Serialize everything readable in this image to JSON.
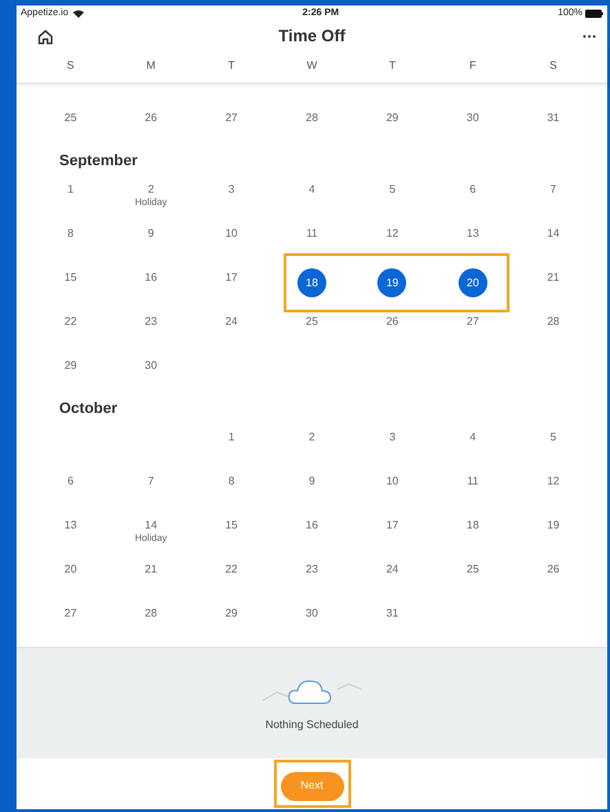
{
  "status_bar": {
    "carrier": "Appetize.io",
    "time": "2:26 PM",
    "battery": "100%"
  },
  "header": {
    "title": "Time Off"
  },
  "weekdays": [
    "S",
    "M",
    "T",
    "W",
    "T",
    "F",
    "S"
  ],
  "sections": [
    {
      "weeks": [
        {
          "highlighted": false,
          "days": [
            {
              "kind": "date",
              "day": "25",
              "selected": false
            },
            {
              "kind": "date",
              "day": "26",
              "selected": false
            },
            {
              "kind": "date",
              "day": "27",
              "selected": false
            },
            {
              "kind": "date",
              "day": "28",
              "selected": false
            },
            {
              "kind": "date",
              "day": "29",
              "selected": false
            },
            {
              "kind": "date",
              "day": "30",
              "selected": false
            },
            {
              "kind": "date",
              "day": "31",
              "selected": false
            }
          ]
        }
      ]
    },
    {
      "title": "September",
      "weeks": [
        {
          "highlighted": false,
          "days": [
            {
              "kind": "date",
              "day": "1",
              "selected": false
            },
            {
              "kind": "date",
              "day": "2",
              "selected": false,
              "note": "Holiday"
            },
            {
              "kind": "date",
              "day": "3",
              "selected": false
            },
            {
              "kind": "date",
              "day": "4",
              "selected": false
            },
            {
              "kind": "date",
              "day": "5",
              "selected": false
            },
            {
              "kind": "date",
              "day": "6",
              "selected": false
            },
            {
              "kind": "date",
              "day": "7",
              "selected": false
            }
          ]
        },
        {
          "highlighted": false,
          "days": [
            {
              "kind": "date",
              "day": "8",
              "selected": false
            },
            {
              "kind": "date",
              "day": "9",
              "selected": false
            },
            {
              "kind": "date",
              "day": "10",
              "selected": false
            },
            {
              "kind": "date",
              "day": "11",
              "selected": false
            },
            {
              "kind": "date",
              "day": "12",
              "selected": false
            },
            {
              "kind": "date",
              "day": "13",
              "selected": false
            },
            {
              "kind": "date",
              "day": "14",
              "selected": false
            }
          ]
        },
        {
          "highlighted": true,
          "days": [
            {
              "kind": "date",
              "day": "15",
              "selected": false
            },
            {
              "kind": "date",
              "day": "16",
              "selected": false
            },
            {
              "kind": "date",
              "day": "17",
              "selected": false
            },
            {
              "kind": "date",
              "day": "18",
              "selected": true
            },
            {
              "kind": "date",
              "day": "19",
              "selected": true
            },
            {
              "kind": "date",
              "day": "20",
              "selected": true
            },
            {
              "kind": "date",
              "day": "21",
              "selected": false
            }
          ]
        },
        {
          "highlighted": false,
          "days": [
            {
              "kind": "date",
              "day": "22",
              "selected": false
            },
            {
              "kind": "date",
              "day": "23",
              "selected": false
            },
            {
              "kind": "date",
              "day": "24",
              "selected": false
            },
            {
              "kind": "date",
              "day": "25",
              "selected": false
            },
            {
              "kind": "date",
              "day": "26",
              "selected": false
            },
            {
              "kind": "date",
              "day": "27",
              "selected": false
            },
            {
              "kind": "date",
              "day": "28",
              "selected": false
            }
          ]
        },
        {
          "highlighted": false,
          "days": [
            {
              "kind": "date",
              "day": "29",
              "selected": false
            },
            {
              "kind": "date",
              "day": "30",
              "selected": false
            },
            {
              "kind": "blank"
            },
            {
              "kind": "blank"
            },
            {
              "kind": "blank"
            },
            {
              "kind": "blank"
            },
            {
              "kind": "blank"
            }
          ]
        }
      ]
    },
    {
      "title": "October",
      "weeks": [
        {
          "highlighted": false,
          "days": [
            {
              "kind": "blank"
            },
            {
              "kind": "blank"
            },
            {
              "kind": "date",
              "day": "1",
              "selected": false
            },
            {
              "kind": "date",
              "day": "2",
              "selected": false
            },
            {
              "kind": "date",
              "day": "3",
              "selected": false
            },
            {
              "kind": "date",
              "day": "4",
              "selected": false
            },
            {
              "kind": "date",
              "day": "5",
              "selected": false
            }
          ]
        },
        {
          "highlighted": false,
          "days": [
            {
              "kind": "date",
              "day": "6",
              "selected": false
            },
            {
              "kind": "date",
              "day": "7",
              "selected": false
            },
            {
              "kind": "date",
              "day": "8",
              "selected": false
            },
            {
              "kind": "date",
              "day": "9",
              "selected": false
            },
            {
              "kind": "date",
              "day": "10",
              "selected": false
            },
            {
              "kind": "date",
              "day": "11",
              "selected": false
            },
            {
              "kind": "date",
              "day": "12",
              "selected": false
            }
          ]
        },
        {
          "highlighted": false,
          "days": [
            {
              "kind": "date",
              "day": "13",
              "selected": false
            },
            {
              "kind": "date",
              "day": "14",
              "selected": false,
              "note": "Holiday"
            },
            {
              "kind": "date",
              "day": "15",
              "selected": false
            },
            {
              "kind": "date",
              "day": "16",
              "selected": false
            },
            {
              "kind": "date",
              "day": "17",
              "selected": false
            },
            {
              "kind": "date",
              "day": "18",
              "selected": false
            },
            {
              "kind": "date",
              "day": "19",
              "selected": false
            }
          ]
        },
        {
          "highlighted": false,
          "days": [
            {
              "kind": "date",
              "day": "20",
              "selected": false
            },
            {
              "kind": "date",
              "day": "21",
              "selected": false
            },
            {
              "kind": "date",
              "day": "22",
              "selected": false
            },
            {
              "kind": "date",
              "day": "23",
              "selected": false
            },
            {
              "kind": "date",
              "day": "24",
              "selected": false
            },
            {
              "kind": "date",
              "day": "25",
              "selected": false
            },
            {
              "kind": "date",
              "day": "26",
              "selected": false
            }
          ]
        },
        {
          "highlighted": false,
          "days": [
            {
              "kind": "date",
              "day": "27",
              "selected": false
            },
            {
              "kind": "date",
              "day": "28",
              "selected": false
            },
            {
              "kind": "date",
              "day": "29",
              "selected": false
            },
            {
              "kind": "date",
              "day": "30",
              "selected": false
            },
            {
              "kind": "date",
              "day": "31",
              "selected": false
            },
            {
              "kind": "blank"
            },
            {
              "kind": "blank"
            }
          ]
        }
      ]
    }
  ],
  "empty_state": {
    "message": "Nothing Scheduled"
  },
  "next_button": {
    "label": "Next",
    "highlighted": true
  }
}
